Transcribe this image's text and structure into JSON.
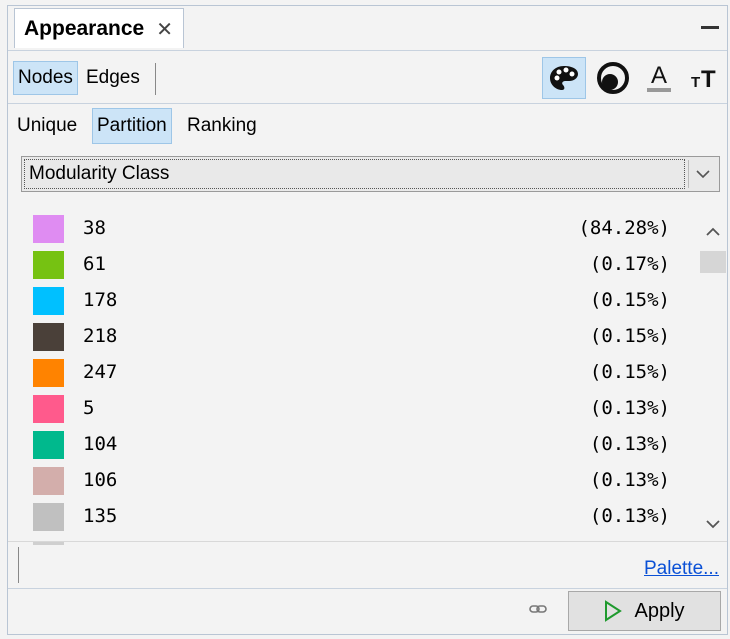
{
  "window": {
    "title": "Appearance",
    "close_glyph": "✕"
  },
  "element_tabs": [
    {
      "label": "Nodes",
      "selected": true
    },
    {
      "label": "Edges",
      "selected": false
    }
  ],
  "tools": [
    {
      "icon": "palette-icon",
      "selected": true
    },
    {
      "icon": "size-icon",
      "selected": false
    },
    {
      "icon": "label-color-icon",
      "selected": false
    },
    {
      "icon": "label-size-icon",
      "selected": false
    }
  ],
  "mode_tabs": [
    {
      "label": "Unique",
      "selected": false
    },
    {
      "label": "Partition",
      "selected": true
    },
    {
      "label": "Ranking",
      "selected": false
    }
  ],
  "attribute_dropdown": {
    "value": "Modularity Class"
  },
  "partition_items": [
    {
      "value": "38",
      "percent": "(84.28%)",
      "color": "#df8cf2"
    },
    {
      "value": "61",
      "percent": "(0.17%)",
      "color": "#76c212"
    },
    {
      "value": "178",
      "percent": "(0.15%)",
      "color": "#00c0ff"
    },
    {
      "value": "218",
      "percent": "(0.15%)",
      "color": "#4a4039"
    },
    {
      "value": "247",
      "percent": "(0.15%)",
      "color": "#ff8300"
    },
    {
      "value": "5",
      "percent": "(0.13%)",
      "color": "#ff5a8c"
    },
    {
      "value": "104",
      "percent": "(0.13%)",
      "color": "#00b98d"
    },
    {
      "value": "106",
      "percent": "(0.13%)",
      "color": "#d3aeab"
    },
    {
      "value": "135",
      "percent": "(0.13%)",
      "color": "#c0c0c0"
    }
  ],
  "palette_link": "Palette...",
  "apply_button": {
    "label": "Apply",
    "icon": "play-icon"
  },
  "colors": {
    "selected_bg": "#cce4f7",
    "link": "#0a50d6"
  }
}
